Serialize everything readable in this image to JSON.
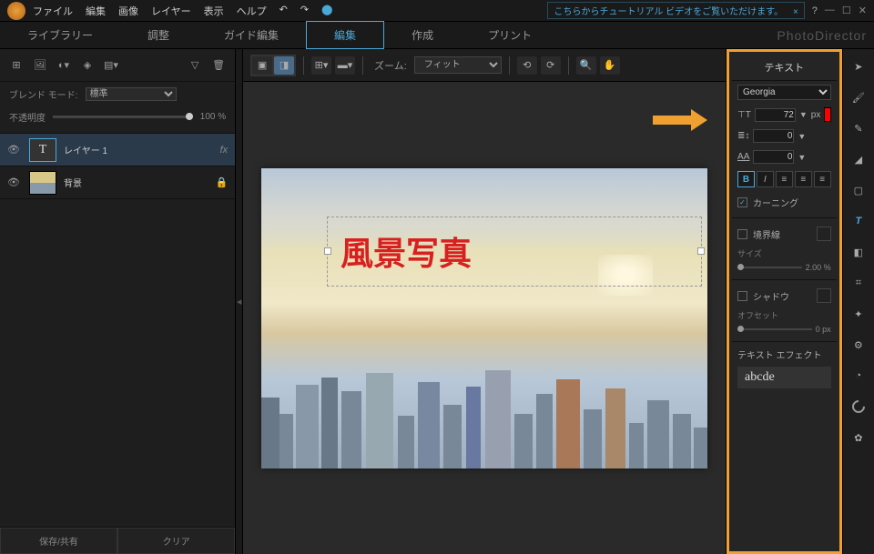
{
  "app": {
    "brand": "PhotoDirector"
  },
  "menu": {
    "file": "ファイル",
    "edit": "編集",
    "image": "画像",
    "layer": "レイヤー",
    "view": "表示",
    "help": "ヘルプ"
  },
  "tutorial": {
    "text": "こちらからチュートリアル ビデオをご覧いただけます。",
    "close": "×"
  },
  "tabs": {
    "library": "ライブラリー",
    "adjust": "調整",
    "guide": "ガイド編集",
    "edit": "編集",
    "create": "作成",
    "print": "プリント"
  },
  "leftToolbar": {
    "filter": "▽",
    "trash": "🗑"
  },
  "blend": {
    "label": "ブレンド モード:",
    "value": "標準"
  },
  "opacity": {
    "label": "不透明度",
    "value": "100 %"
  },
  "layers": [
    {
      "thumb": "T",
      "name": "レイヤー 1",
      "fx": "fx",
      "selected": true
    },
    {
      "thumb": "",
      "name": "背景",
      "lock": "🔒",
      "selected": false
    }
  ],
  "leftButtons": {
    "save": "保存/共有",
    "clear": "クリア"
  },
  "centerToolbar": {
    "zoomLabel": "ズーム:",
    "zoomValue": "フィット"
  },
  "canvasText": "風景写真",
  "textPanel": {
    "title": "テキスト",
    "font": "Georgia",
    "size": "72",
    "sizeUnit": "px",
    "lineHeight": "0",
    "tracking": "0",
    "kerning": "カーニング",
    "border": "境界線",
    "sizeLabel": "サイズ",
    "sizeValue": "2.00 %",
    "shadow": "シャドウ",
    "offsetLabel": "オフセット",
    "offsetValue": "0 px",
    "effectLabel": "テキスト エフェクト",
    "effectPreview": "abcde"
  }
}
